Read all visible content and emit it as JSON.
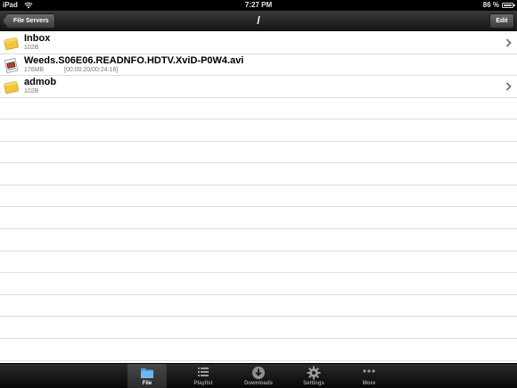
{
  "status_bar": {
    "carrier": "iPad",
    "time": "7:27 PM",
    "battery_text": "86 %",
    "battery_level": 0.86
  },
  "nav_bar": {
    "back_label": "File Servers",
    "title": "/",
    "edit_label": "Edit"
  },
  "files": [
    {
      "name": "Inbox",
      "size": "102B",
      "progress": "",
      "type": "folder-icon",
      "has_chevron": true
    },
    {
      "name": "Weeds.S06E06.READNFO.HDTV.XviD-P0W4.avi",
      "size": "176MB",
      "progress": "[00:00:20/00:24:16]",
      "type": "video-file-icon",
      "has_chevron": false
    },
    {
      "name": "admob",
      "size": "102B",
      "progress": "",
      "type": "folder-icon",
      "has_chevron": true
    }
  ],
  "tab_bar": {
    "selected": "File",
    "tabs": [
      {
        "label": "File",
        "icon": "folder-icon"
      },
      {
        "label": "Playlist",
        "icon": "list-icon"
      },
      {
        "label": "Downloads",
        "icon": "download-icon"
      },
      {
        "label": "Settings",
        "icon": "gear-icon"
      },
      {
        "label": "More",
        "icon": "more-dots-icon"
      }
    ]
  },
  "colors": {
    "folder": "#f2c53d",
    "selected_tab_icon": "#4a9be8",
    "row_divider": "#dcdcdc"
  }
}
